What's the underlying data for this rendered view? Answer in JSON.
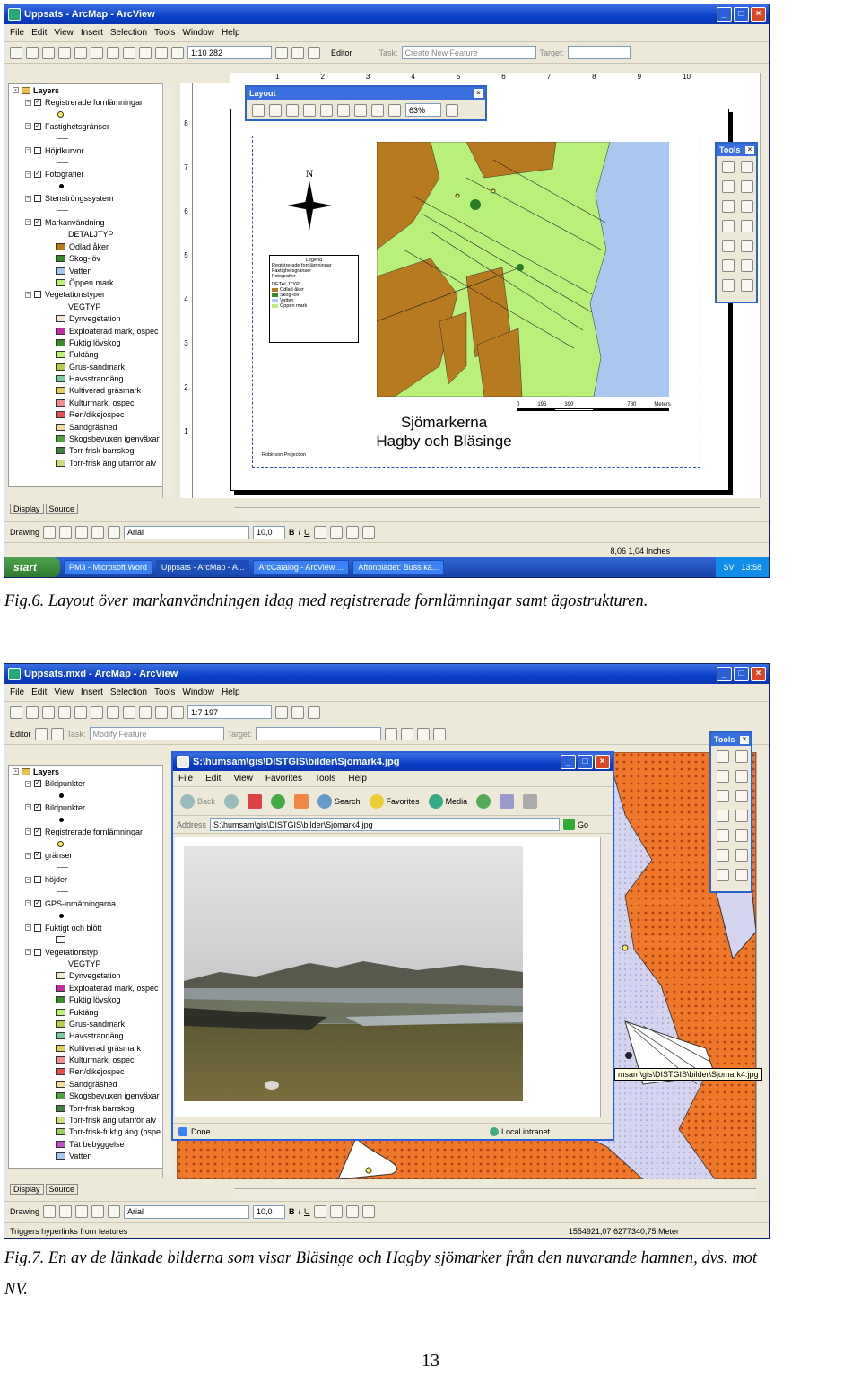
{
  "fig6": {
    "title": "Uppsats - ArcMap - ArcView",
    "menu": [
      "File",
      "Edit",
      "View",
      "Insert",
      "Selection",
      "Tools",
      "Window",
      "Help"
    ],
    "scale": "1:10 282",
    "editor": "Editor",
    "task_label": "Task:",
    "task_value": "Create New Feature",
    "target_label": "Target:",
    "layout_toolbar": {
      "title": "Layout",
      "zoom": "63%"
    },
    "toc": {
      "root": "Layers",
      "rows": [
        {
          "type": "layer",
          "label": "Registrerade fornlämningar",
          "checked": true
        },
        {
          "type": "symbol",
          "label": "",
          "color": "#f6ee50"
        },
        {
          "type": "layer",
          "label": "Fastighetsgränser",
          "checked": true
        },
        {
          "type": "line",
          "label": ""
        },
        {
          "type": "layer",
          "label": "Höjdkurvor",
          "checked": false
        },
        {
          "type": "line",
          "label": ""
        },
        {
          "type": "layer",
          "label": "Fotografier",
          "checked": true
        },
        {
          "type": "dot",
          "label": ""
        },
        {
          "type": "layer",
          "label": "Stenströngssystem",
          "checked": false
        },
        {
          "type": "line",
          "label": ""
        },
        {
          "type": "layer",
          "label": "Markanvändning",
          "checked": true
        },
        {
          "type": "text",
          "label": "DETALJTYP"
        },
        {
          "type": "class",
          "label": "Odlad åker",
          "color": "#b87a1e"
        },
        {
          "type": "class",
          "label": "Skog-löv",
          "color": "#3a8a2a"
        },
        {
          "type": "class",
          "label": "Vatten",
          "color": "#a8c8ef"
        },
        {
          "type": "class",
          "label": "Öppen mark",
          "color": "#b8f07a"
        },
        {
          "type": "layer",
          "label": "Vegetationstyper",
          "checked": false
        },
        {
          "type": "text",
          "label": "VEGTYP"
        },
        {
          "type": "class",
          "label": "Dynvegetation",
          "color": "#f2ead0"
        },
        {
          "type": "class",
          "label": "Exploaterad mark, ospec",
          "color": "#c030a0"
        },
        {
          "type": "class",
          "label": "Fuktig lövskog",
          "color": "#3a8a2a"
        },
        {
          "type": "class",
          "label": "Fuktäng",
          "color": "#b8f07a"
        },
        {
          "type": "class",
          "label": "Grus-sandmark",
          "color": "#b8c850"
        },
        {
          "type": "class",
          "label": "Havsstrandäng",
          "color": "#78c8a0"
        },
        {
          "type": "class",
          "label": "Kultiverad gräsmark",
          "color": "#e0d060"
        },
        {
          "type": "class",
          "label": "Kulturmark, ospec",
          "color": "#f09090"
        },
        {
          "type": "class",
          "label": "Ren/dikejospec",
          "color": "#e05050"
        },
        {
          "type": "class",
          "label": "Sandgräshed",
          "color": "#f0e0a0"
        },
        {
          "type": "class",
          "label": "Skogsbevuxen igenväxar",
          "color": "#50a040"
        },
        {
          "type": "class",
          "label": "Torr-frisk barrskog",
          "color": "#408040"
        },
        {
          "type": "class",
          "label": "Torr-frisk äng utanför alv",
          "color": "#c8e080"
        }
      ]
    },
    "tabs": [
      "Display",
      "Source"
    ],
    "drawing": "Drawing",
    "font": "Arial",
    "font_size": "10,0",
    "coords": "8,06  1,04 Inches",
    "map": {
      "north": "N",
      "title1": "Sjömarkerna",
      "title2": "Hagby och Bläsinge",
      "scale_ticks": [
        "0",
        "195",
        "390",
        "780"
      ],
      "scale_unit": "Meters",
      "legend_title": "Legend",
      "legend_items": [
        "Registrerade fornlämningar",
        "Fastighetsgränser",
        "Fotografier",
        "DETALJTYP",
        "Odlad åker",
        "Skog-löv",
        "Vatten",
        "Öppen mark"
      ],
      "projection": "Robinson Projection"
    },
    "tools_title": "Tools",
    "taskbar": {
      "start": "start",
      "tasks": [
        "PM3 - Microsoft Word",
        "Uppsats - ArcMap - A...",
        "ArcCatalog - ArcView ...",
        "Aftonbladet: Buss ka..."
      ],
      "lang": "SV",
      "time": "13:58"
    },
    "ruler_h": [
      "1",
      "2",
      "3",
      "4",
      "5",
      "6",
      "7",
      "8",
      "9",
      "10"
    ],
    "ruler_v": [
      "8",
      "7",
      "6",
      "5",
      "4",
      "3",
      "2",
      "1"
    ]
  },
  "caption6": "Fig.6. Layout över markanvändningen idag med registrerade fornlämningar samt ägostrukturen.",
  "fig7": {
    "title": "Uppsats.mxd - ArcMap - ArcView",
    "menu": [
      "File",
      "Edit",
      "View",
      "Insert",
      "Selection",
      "Tools",
      "Window",
      "Help"
    ],
    "scale": "1:7 197",
    "editor": "Editor",
    "task_label": "Task:",
    "task_value": "Modify Feature",
    "target_label": "Target:",
    "toc": {
      "root": "Layers",
      "rows": [
        {
          "type": "layer",
          "label": "Bildpunkter",
          "checked": true
        },
        {
          "type": "dot",
          "label": ""
        },
        {
          "type": "layer",
          "label": "Bildpunkter",
          "checked": true
        },
        {
          "type": "dot",
          "label": ""
        },
        {
          "type": "layer",
          "label": "Registrerade fornlämningar",
          "checked": true
        },
        {
          "type": "symbol",
          "label": "",
          "color": "#f6ee50"
        },
        {
          "type": "layer",
          "label": "gränser",
          "checked": true
        },
        {
          "type": "line",
          "label": ""
        },
        {
          "type": "layer",
          "label": "höjder",
          "checked": false
        },
        {
          "type": "line",
          "label": ""
        },
        {
          "type": "layer",
          "label": "GPS-inmätningarna",
          "checked": true
        },
        {
          "type": "dot",
          "label": ""
        },
        {
          "type": "layer",
          "label": "Fuktigt och blött",
          "checked": false
        },
        {
          "type": "class",
          "label": "",
          "color": "#ffffff"
        },
        {
          "type": "layer",
          "label": "Vegetationstyp",
          "checked": false
        },
        {
          "type": "text",
          "label": "VEGTYP"
        },
        {
          "type": "class",
          "label": "Dynvegetation",
          "color": "#f2ead0"
        },
        {
          "type": "class",
          "label": "Exploaterad mark, ospec",
          "color": "#c030a0"
        },
        {
          "type": "class",
          "label": "Fuktig lövskog",
          "color": "#3a8a2a"
        },
        {
          "type": "class",
          "label": "Fuktäng",
          "color": "#b8f07a"
        },
        {
          "type": "class",
          "label": "Grus-sandmark",
          "color": "#b8c850"
        },
        {
          "type": "class",
          "label": "Havsstrandäng",
          "color": "#78c8a0"
        },
        {
          "type": "class",
          "label": "Kultiverad gräsmark",
          "color": "#e0d060"
        },
        {
          "type": "class",
          "label": "Kulturmark, ospec",
          "color": "#f09090"
        },
        {
          "type": "class",
          "label": "Ren/dikejospec",
          "color": "#e05050"
        },
        {
          "type": "class",
          "label": "Sandgräshed",
          "color": "#f0e0a0"
        },
        {
          "type": "class",
          "label": "Skogsbevuxen igenväxar",
          "color": "#50a040"
        },
        {
          "type": "class",
          "label": "Torr-frisk barrskog",
          "color": "#408040"
        },
        {
          "type": "class",
          "label": "Torr-frisk äng utanför alv",
          "color": "#c8e080"
        },
        {
          "type": "class",
          "label": "Torr-frisk-fuktig äng (ospe",
          "color": "#a0d060"
        },
        {
          "type": "class",
          "label": "Tät bebyggelse",
          "color": "#c050c0"
        },
        {
          "type": "class",
          "label": "Vatten",
          "color": "#a8c8ef"
        }
      ]
    },
    "tabs": [
      "Display",
      "Source"
    ],
    "drawing": "Drawing",
    "font": "Arial",
    "font_size": "10,0",
    "status_left": "Triggers hyperlinks from features",
    "status_right": "1554921,07  6277340,75 Meter",
    "tools_title": "Tools",
    "browser": {
      "title": "S:\\humsam\\gis\\DISTGIS\\bilder\\Sjomark4.jpg",
      "menu": [
        "File",
        "Edit",
        "View",
        "Favorites",
        "Tools",
        "Help"
      ],
      "back": "Back",
      "search": "Search",
      "favorites": "Favorites",
      "media": "Media",
      "address_label": "Address",
      "address": "S:\\humsam\\gis\\DISTGIS\\bilder\\Sjomark4.jpg",
      "go": "Go",
      "status": "Done",
      "zone": "Local intranet"
    },
    "tooltip": "msam\\gis\\DISTGIS\\bilder\\Sjomark4.jpg"
  },
  "caption7_line1": "Fig.7. En av de länkade bilderna som visar Bläsinge och Hagby sjömarker från den nuvarande hamnen, dvs. mot",
  "caption7_line2": "NV.",
  "page_number": "13"
}
